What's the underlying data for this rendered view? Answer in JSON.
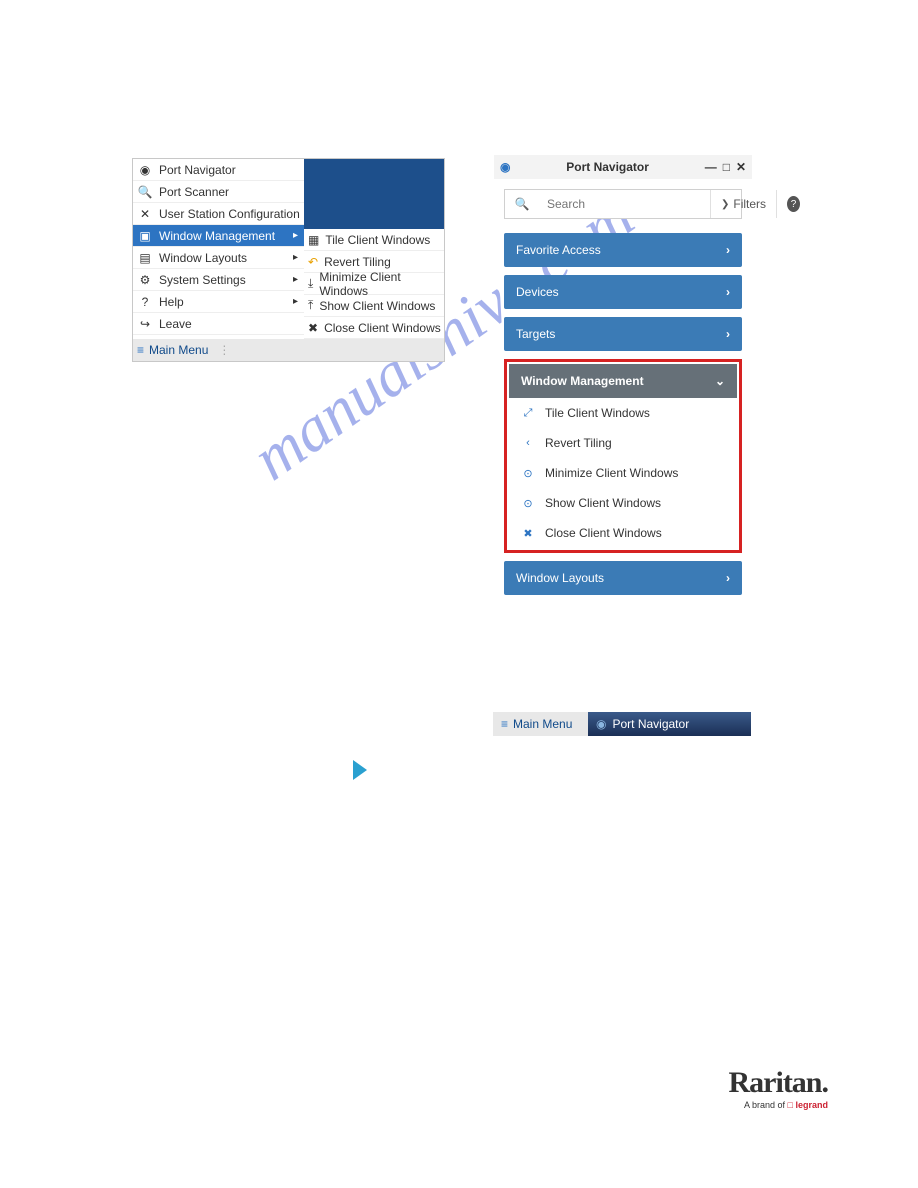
{
  "watermark": "manualshive.com",
  "main_menu": {
    "title": "Main Menu",
    "items": [
      {
        "label": "Port Navigator",
        "icon": "◉",
        "has_sub": false
      },
      {
        "label": "Port Scanner",
        "icon": "🔍",
        "has_sub": false
      },
      {
        "label": "User Station Configuration",
        "icon": "✕",
        "has_sub": false
      },
      {
        "label": "Window Management",
        "icon": "▣",
        "has_sub": true,
        "selected": true
      },
      {
        "label": "Window Layouts",
        "icon": "▤",
        "has_sub": true
      },
      {
        "label": "System Settings",
        "icon": "⚙",
        "has_sub": true
      },
      {
        "label": "Help",
        "icon": "?",
        "has_sub": true
      },
      {
        "label": "Leave",
        "icon": "↪",
        "has_sub": false
      }
    ],
    "submenu": [
      {
        "label": "Tile Client Windows",
        "icon": "▦"
      },
      {
        "label": "Revert Tiling",
        "icon": "↶"
      },
      {
        "label": "Minimize Client Windows",
        "icon": "⤓"
      },
      {
        "label": "Show Client Windows",
        "icon": "⤒"
      },
      {
        "label": "Close Client Windows",
        "icon": "✖"
      }
    ]
  },
  "port_nav": {
    "title": "Port Navigator",
    "filters": "Filters",
    "search_placeholder": "Search",
    "sections": [
      {
        "label": "Favorite Access"
      },
      {
        "label": "Devices"
      },
      {
        "label": "Targets"
      }
    ],
    "wm_title": "Window Management",
    "wm_items": [
      {
        "label": "Tile Client Windows",
        "icon": "⤢"
      },
      {
        "label": "Revert Tiling",
        "icon": "‹"
      },
      {
        "label": "Minimize Client Windows",
        "icon": "⊙"
      },
      {
        "label": "Show Client Windows",
        "icon": "⊙"
      },
      {
        "label": "Close Client Windows",
        "icon": "✖"
      }
    ],
    "layouts": "Window Layouts"
  },
  "taskbar": {
    "main": "Main Menu",
    "nav": "Port Navigator"
  },
  "brand": {
    "name": "Raritan.",
    "sub_prefix": "A brand of ",
    "sub_logo": "□ legrand"
  }
}
